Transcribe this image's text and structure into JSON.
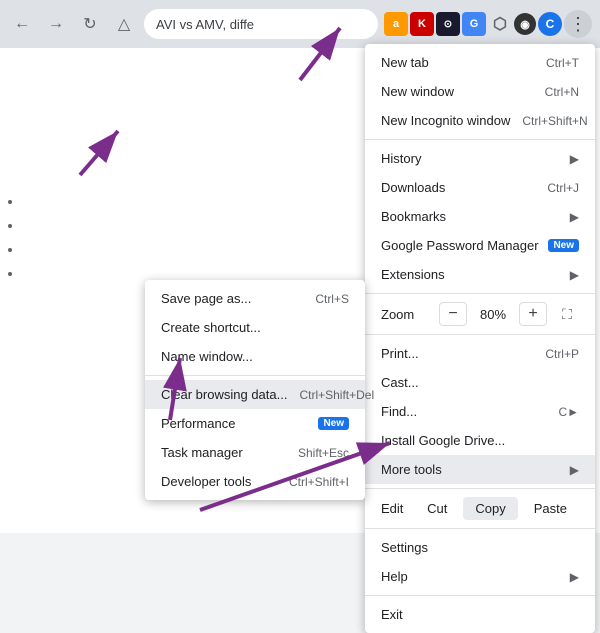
{
  "browser": {
    "title": "AVI vs AMV, diffe",
    "profile_letter": "C"
  },
  "menu": {
    "items": [
      {
        "label": "New tab",
        "shortcut": "Ctrl+T",
        "type": "item"
      },
      {
        "label": "New window",
        "shortcut": "Ctrl+N",
        "type": "item"
      },
      {
        "label": "New Incognito window",
        "shortcut": "Ctrl+Shift+N",
        "type": "item"
      },
      {
        "label": "divider"
      },
      {
        "label": "History",
        "arrow": "▶",
        "type": "item"
      },
      {
        "label": "Downloads",
        "shortcut": "Ctrl+J",
        "type": "item"
      },
      {
        "label": "Bookmarks",
        "arrow": "▶",
        "type": "item"
      },
      {
        "label": "Google Password Manager",
        "badge": "New",
        "type": "item"
      },
      {
        "label": "Extensions",
        "arrow": "▶",
        "type": "item"
      },
      {
        "label": "divider"
      },
      {
        "label": "Zoom",
        "zoom": true,
        "type": "zoom"
      },
      {
        "label": "divider"
      },
      {
        "label": "Print...",
        "shortcut": "Ctrl+P",
        "type": "item"
      },
      {
        "label": "Cast...",
        "type": "item"
      },
      {
        "label": "Find...",
        "shortcut": "C►",
        "type": "item"
      },
      {
        "label": "Install Google Drive...",
        "type": "item"
      },
      {
        "label": "More tools",
        "arrow": "▶",
        "type": "item",
        "active": true
      },
      {
        "label": "divider"
      },
      {
        "label": "edit_row",
        "type": "edit"
      },
      {
        "label": "divider"
      },
      {
        "label": "Settings",
        "type": "item"
      },
      {
        "label": "Help",
        "arrow": "▶",
        "type": "item"
      },
      {
        "label": "divider"
      },
      {
        "label": "Exit",
        "type": "item"
      }
    ],
    "zoom_minus": "−",
    "zoom_value": "80%",
    "zoom_plus": "+",
    "edit_label": "Edit",
    "cut_label": "Cut",
    "copy_label": "Copy",
    "paste_label": "Paste"
  },
  "submenu": {
    "items": [
      {
        "label": "Save page as...",
        "shortcut": "Ctrl+S"
      },
      {
        "label": "Create shortcut..."
      },
      {
        "label": "Name window..."
      },
      {
        "label": "divider"
      },
      {
        "label": "Clear browsing data...",
        "shortcut": "Ctrl+Shift+Del",
        "highlighted": true
      },
      {
        "label": "Performance",
        "badge": "New"
      },
      {
        "label": "Task manager",
        "shortcut": "Shift+Esc"
      },
      {
        "label": "Developer tools",
        "shortcut": "Ctrl+Shift+I"
      }
    ]
  }
}
